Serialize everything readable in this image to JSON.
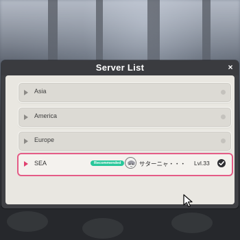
{
  "dialog": {
    "title": "Server List",
    "close_glyph": "×"
  },
  "servers": [
    {
      "name": "Asia",
      "selected": false
    },
    {
      "name": "America",
      "selected": false
    },
    {
      "name": "Europe",
      "selected": false
    },
    {
      "name": "SEA",
      "selected": true,
      "badge": "Recommended",
      "player_name": "サターニャ・・・",
      "level": "Lvl.33"
    }
  ],
  "colors": {
    "accent_pink": "#e45b86",
    "badge_green": "#28c79a",
    "panel_dark": "#3f4044",
    "panel_light": "#e9e7e1"
  },
  "icons": [
    "close-icon",
    "row-marker-icon",
    "radio-icon",
    "avatar",
    "checkmark-icon",
    "mouse-cursor-icon"
  ]
}
